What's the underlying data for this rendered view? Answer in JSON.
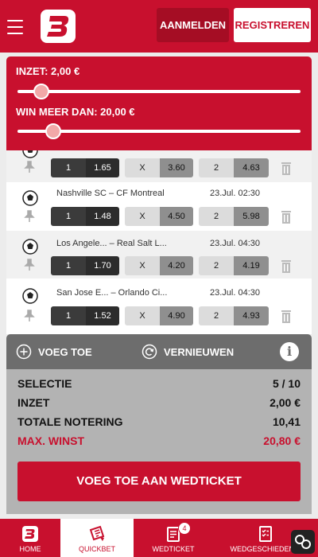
{
  "header": {
    "login_label": "AANMELDEN",
    "register_label": "REGISTREREN",
    "brand_color": "#c8102e"
  },
  "sliders": {
    "stake_label": "INZET: 2,00 €",
    "win_label": "WIN MEER DAN: 20,00 €"
  },
  "matches": [
    {
      "home": "",
      "away": "",
      "time": "",
      "odds": [
        {
          "k": "1",
          "v": "1.65"
        },
        {
          "k": "X",
          "v": "3.60"
        },
        {
          "k": "2",
          "v": "4.63"
        }
      ]
    },
    {
      "home": "Nashville SC",
      "away": "CF Montreal",
      "time": "23.Jul. 02:30",
      "odds": [
        {
          "k": "1",
          "v": "1.48"
        },
        {
          "k": "X",
          "v": "4.50"
        },
        {
          "k": "2",
          "v": "5.98"
        }
      ]
    },
    {
      "home": "Los Angele...",
      "away": "Real Salt L...",
      "time": "23.Jul. 04:30",
      "odds": [
        {
          "k": "1",
          "v": "1.70"
        },
        {
          "k": "X",
          "v": "4.20"
        },
        {
          "k": "2",
          "v": "4.19"
        }
      ]
    },
    {
      "home": "San Jose E...",
      "away": "Orlando Ci...",
      "time": "23.Jul. 04:30",
      "odds": [
        {
          "k": "1",
          "v": "1.52"
        },
        {
          "k": "X",
          "v": "4.90"
        },
        {
          "k": "2",
          "v": "4.93"
        }
      ]
    }
  ],
  "actions": {
    "add_label": "VOEG TOE",
    "refresh_label": "VERNIEUWEN",
    "info_label": "i"
  },
  "summary": {
    "selection_label": "SELECTIE",
    "selection_value": "5 / 10",
    "stake_label": "INZET",
    "stake_value": "2,00 €",
    "total_label": "TOTALE NOTERING",
    "total_value": "10,41",
    "max_label": "MAX. WINST",
    "max_value": "20,80 €",
    "cta_label": "VOEG TOE AAN WEDTICKET"
  },
  "nav": {
    "home": "HOME",
    "quickbet": "QUICKBET",
    "ticket": "WEDTICKET",
    "ticket_badge": "4",
    "history": "WEDGESCHIEDENIS"
  }
}
